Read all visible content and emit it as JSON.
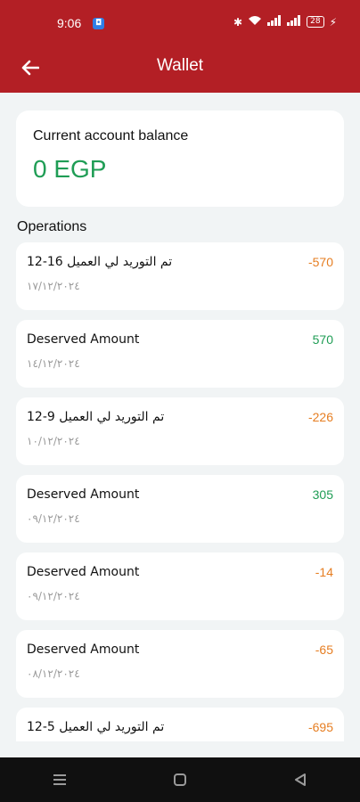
{
  "status_bar": {
    "time": "9:06",
    "battery": "28"
  },
  "app_bar": {
    "title": "Wallet"
  },
  "balance": {
    "label": "Current account balance",
    "value": "0 EGP"
  },
  "operations": {
    "title": "Operations",
    "items": [
      {
        "description": "تم التوريد لي العميل 16-12",
        "date": "١٧/١٢/٢٠٢٤",
        "amount": "-570",
        "color": "#e67e22"
      },
      {
        "description": "Deserved Amount",
        "date": "١٤/١٢/٢٠٢٤",
        "amount": "570",
        "color": "#1f9d55"
      },
      {
        "description": "تم التوريد لي العميل 9-12",
        "date": "١٠/١٢/٢٠٢٤",
        "amount": "-226",
        "color": "#e67e22"
      },
      {
        "description": "Deserved Amount",
        "date": "٠٩/١٢/٢٠٢٤",
        "amount": "305",
        "color": "#1f9d55"
      },
      {
        "description": "Deserved Amount",
        "date": "٠٩/١٢/٢٠٢٤",
        "amount": "-14",
        "color": "#e67e22"
      },
      {
        "description": "Deserved Amount",
        "date": "٠٨/١٢/٢٠٢٤",
        "amount": "-65",
        "color": "#e67e22"
      },
      {
        "description": "تم التوريد لي العميل 5-12",
        "date": "",
        "amount": "-695",
        "color": "#e67e22"
      }
    ]
  },
  "colors": {
    "primary": "#b31f25",
    "positive": "#1f9d55",
    "negative": "#e67e22",
    "background": "#f1f4f5"
  },
  "icons": {
    "back": "arrow-left-icon",
    "nav_menu": "menu-icon",
    "nav_home": "square-icon",
    "nav_back": "triangle-back-icon"
  }
}
